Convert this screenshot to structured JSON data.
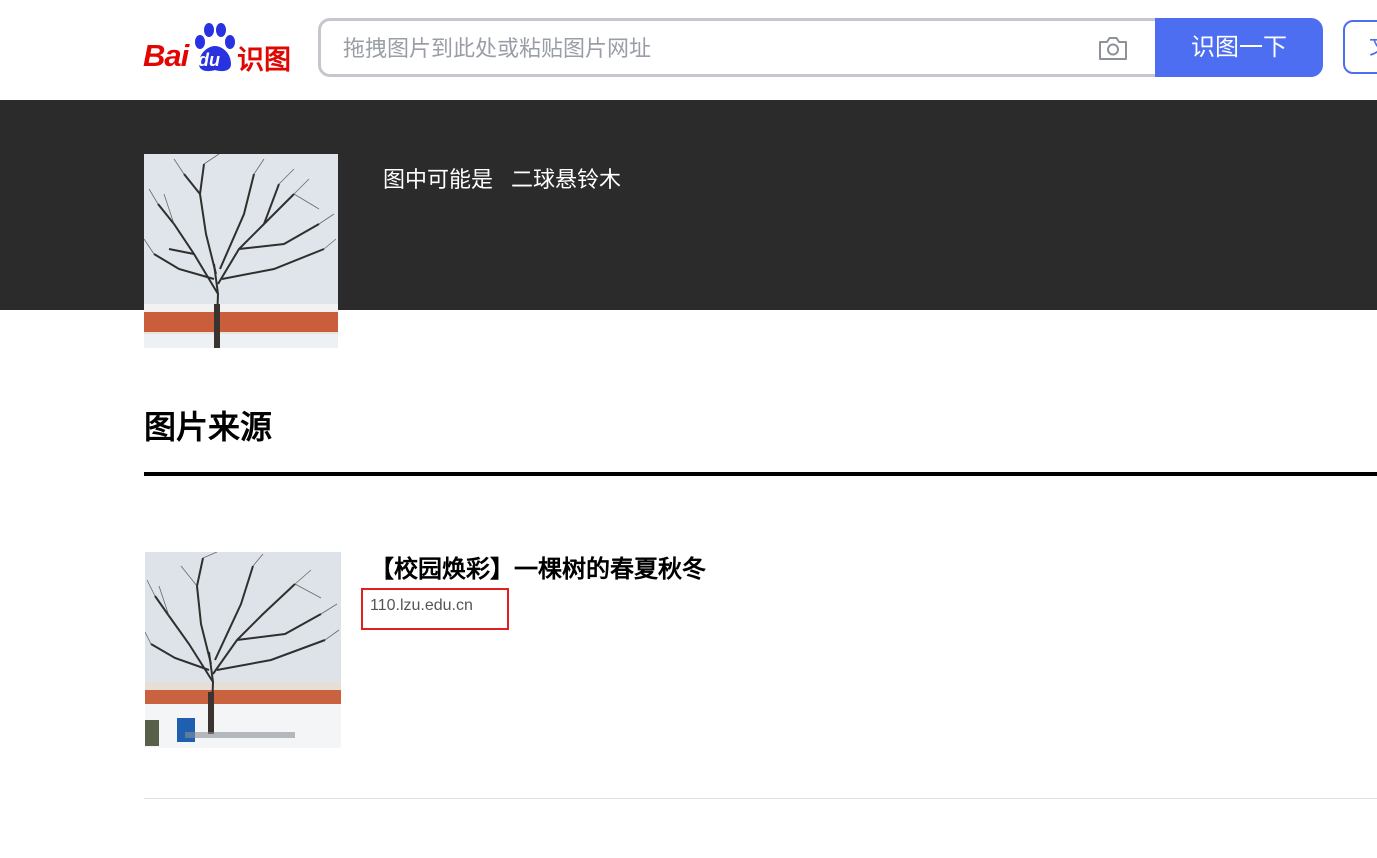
{
  "header": {
    "logo_bai": "Bai",
    "logo_du": "du",
    "logo_suffix": "识图",
    "search_placeholder": "拖拽图片到此处或粘贴图片网址",
    "search_button": "识图一下",
    "extra_button": "文"
  },
  "banner": {
    "guess_label": "图中可能是",
    "guess_value": "二球悬铃木"
  },
  "sources": {
    "title": "图片来源",
    "results": [
      {
        "title": "【校园焕彩】一棵树的春夏秋冬",
        "domain": "110.lzu.edu.cn"
      }
    ]
  },
  "colors": {
    "brand_red": "#e10601",
    "brand_blue": "#4e6ef2",
    "banner_bg": "#2b2b2b",
    "highlight": "#e02020"
  }
}
